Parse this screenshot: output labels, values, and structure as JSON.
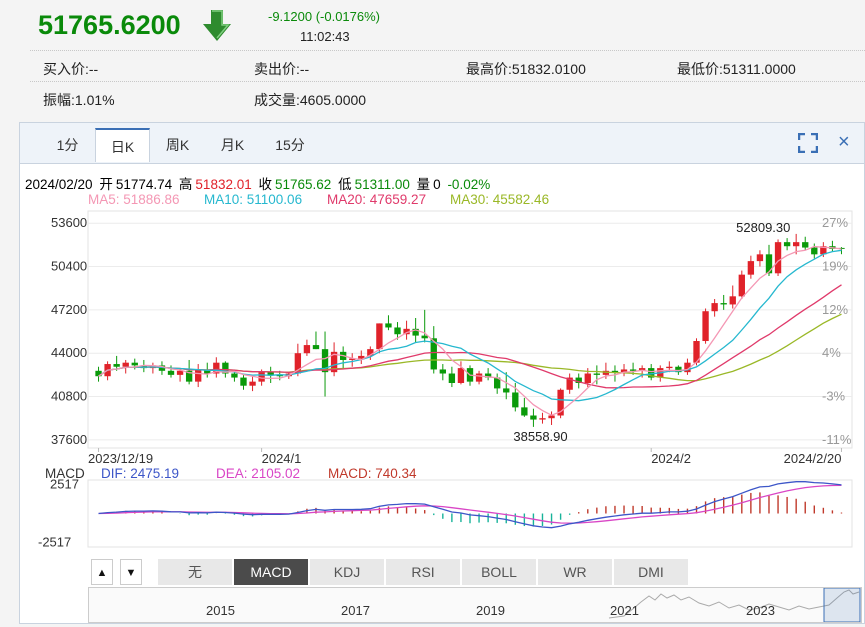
{
  "quote": {
    "price": "51765.6200",
    "change": "-9.1200 (-0.0176%)",
    "time": "11:02:43",
    "bid": "买入价:--",
    "ask": "卖出价:--",
    "high": "最高价:51832.0100",
    "low": "最低价:51311.0000",
    "amplitude": "振幅:1.01%",
    "volume": "成交量:4605.0000"
  },
  "tabs": [
    {
      "label": "1分",
      "active": false
    },
    {
      "label": "日K",
      "active": true
    },
    {
      "label": "周K",
      "active": false
    },
    {
      "label": "月K",
      "active": false
    },
    {
      "label": "15分",
      "active": false
    }
  ],
  "ohlc": {
    "date": "2024/02/20",
    "open_label": "开",
    "open": "51774.74",
    "high_label": "高",
    "high": "51832.01",
    "close_label": "收",
    "close": "51765.62",
    "low_label": "低",
    "low": "51311.00",
    "vol_label": "量",
    "vol": "0",
    "change": "-0.02%"
  },
  "ma_legend": {
    "ma5": "MA5: 51886.86",
    "ma10": "MA10: 51100.06",
    "ma20": "MA20: 47659.27",
    "ma30": "MA30: 45582.46"
  },
  "macd_legend": {
    "title": "MACD",
    "dif": "DIF: 2475.19",
    "dea": "DEA: 2105.02",
    "macd": "MACD: 740.34"
  },
  "indicators": [
    {
      "label": "无",
      "active": false
    },
    {
      "label": "MACD",
      "active": true
    },
    {
      "label": "KDJ",
      "active": false
    },
    {
      "label": "RSI",
      "active": false
    },
    {
      "label": "BOLL",
      "active": false
    },
    {
      "label": "WR",
      "active": false
    },
    {
      "label": "DMI",
      "active": false
    }
  ],
  "overview_years": [
    "2015",
    "2017",
    "2019",
    "2021",
    "2023"
  ],
  "colors": {
    "up": "#e0222a",
    "down": "#0a9a0a",
    "ma5": "#f497b4",
    "ma10": "#26b8cf",
    "ma20": "#e03a6b",
    "ma30": "#9ab827",
    "dif": "#3d56c8",
    "dea": "#d946c6"
  },
  "chart_data": {
    "type": "candlestick",
    "price_axis": {
      "ticks": [
        "53600",
        "50400",
        "47200",
        "44000",
        "40800",
        "37600"
      ],
      "ylim": [
        37000,
        54500
      ]
    },
    "pct_axis": {
      "ticks": [
        "27%",
        "19%",
        "12%",
        "4%",
        "-3%",
        "-11%"
      ]
    },
    "x_ticks": [
      "2023/12/19",
      "2024/1",
      "2024/2",
      "2024/2/20"
    ],
    "annotations": {
      "max_label": "52809.30",
      "min_label": "38558.90"
    },
    "macd_axis": {
      "ticks": [
        "2517",
        "-2517"
      ]
    },
    "candles": [
      [
        42700,
        43000,
        41900,
        42300
      ],
      [
        42300,
        43400,
        42000,
        43200
      ],
      [
        43200,
        43800,
        42700,
        43000
      ],
      [
        43000,
        43500,
        42500,
        43300
      ],
      [
        43300,
        43600,
        42800,
        43100
      ],
      [
        43100,
        43500,
        42600,
        42900
      ],
      [
        42900,
        43300,
        42500,
        43100
      ],
      [
        43100,
        43400,
        42400,
        42700
      ],
      [
        42700,
        43100,
        42200,
        42400
      ],
      [
        42400,
        42900,
        41900,
        42700
      ],
      [
        42700,
        43500,
        41700,
        41900
      ],
      [
        41900,
        43200,
        41500,
        42800
      ],
      [
        42800,
        43300,
        42200,
        42500
      ],
      [
        42500,
        43700,
        42200,
        43300
      ],
      [
        43300,
        43400,
        42200,
        42500
      ],
      [
        42500,
        42800,
        41900,
        42200
      ],
      [
        42200,
        42400,
        41300,
        41600
      ],
      [
        41600,
        42300,
        41200,
        41900
      ],
      [
        41900,
        42800,
        41600,
        42600
      ],
      [
        42600,
        43000,
        41800,
        42400
      ],
      [
        42400,
        42700,
        42000,
        42300
      ],
      [
        42300,
        42600,
        42100,
        42500
      ],
      [
        42500,
        44700,
        42300,
        44000
      ],
      [
        44000,
        45000,
        43800,
        44600
      ],
      [
        44600,
        45600,
        44300,
        44300
      ],
      [
        44300,
        45600,
        40800,
        42600
      ],
      [
        42600,
        44800,
        42300,
        44100
      ],
      [
        44100,
        44500,
        42900,
        43500
      ],
      [
        43500,
        44000,
        43000,
        43600
      ],
      [
        43600,
        44200,
        43200,
        43800
      ],
      [
        43800,
        44500,
        43500,
        44300
      ],
      [
        44300,
        46200,
        44000,
        46200
      ],
      [
        46200,
        46800,
        45700,
        45900
      ],
      [
        45900,
        46300,
        45000,
        45400
      ],
      [
        45400,
        46400,
        45000,
        45800
      ],
      [
        45800,
        46600,
        44800,
        45300
      ],
      [
        45300,
        47200,
        44800,
        45100
      ],
      [
        45100,
        46000,
        42500,
        42800
      ],
      [
        42800,
        43200,
        42000,
        42500
      ],
      [
        42500,
        43000,
        41500,
        41800
      ],
      [
        41800,
        43400,
        41700,
        42900
      ],
      [
        42900,
        43100,
        41600,
        41900
      ],
      [
        41900,
        42700,
        41700,
        42500
      ],
      [
        42500,
        42900,
        42000,
        42200
      ],
      [
        42200,
        42500,
        41000,
        41400
      ],
      [
        41400,
        42600,
        40600,
        41100
      ],
      [
        41100,
        41800,
        39700,
        40000
      ],
      [
        40000,
        40700,
        39300,
        39400
      ],
      [
        39400,
        39900,
        38559,
        39100
      ],
      [
        39100,
        39600,
        38800,
        39200
      ],
      [
        39200,
        39700,
        38700,
        39400
      ],
      [
        39400,
        41400,
        39200,
        41300
      ],
      [
        41300,
        42500,
        41000,
        42200
      ],
      [
        42200,
        42500,
        41400,
        41800
      ],
      [
        41800,
        42900,
        41500,
        42500
      ],
      [
        42500,
        43100,
        41700,
        42400
      ],
      [
        42400,
        43300,
        42100,
        42700
      ],
      [
        42700,
        43100,
        41900,
        42600
      ],
      [
        42600,
        43200,
        42300,
        42800
      ],
      [
        42800,
        43300,
        42400,
        42700
      ],
      [
        42700,
        43100,
        42200,
        42900
      ],
      [
        42900,
        43200,
        42000,
        42200
      ],
      [
        42200,
        43100,
        41900,
        42900
      ],
      [
        42900,
        43400,
        42600,
        43000
      ],
      [
        43000,
        43100,
        42400,
        42600
      ],
      [
        42600,
        43600,
        42400,
        43300
      ],
      [
        43300,
        45100,
        43100,
        44900
      ],
      [
        44900,
        47300,
        44700,
        47100
      ],
      [
        47100,
        48000,
        46700,
        47700
      ],
      [
        47700,
        48300,
        47200,
        47600
      ],
      [
        47600,
        49000,
        47300,
        48200
      ],
      [
        48200,
        50100,
        48000,
        49800
      ],
      [
        49800,
        51200,
        49500,
        50800
      ],
      [
        50800,
        51600,
        50400,
        51300
      ],
      [
        51300,
        52000,
        49700,
        49900
      ],
      [
        49900,
        52400,
        49700,
        52200
      ],
      [
        52200,
        52500,
        51600,
        51900
      ],
      [
        51900,
        52809,
        51300,
        52200
      ],
      [
        52200,
        52600,
        51600,
        51800
      ],
      [
        51800,
        52100,
        51000,
        51300
      ],
      [
        51300,
        52200,
        51100,
        51900
      ],
      [
        51900,
        52300,
        51500,
        51700
      ],
      [
        51775,
        51832,
        51311,
        51766
      ]
    ],
    "ma5_end": 51886.86,
    "ma10_end": 51100.06,
    "ma20_end": 47659.27,
    "ma30_end": 45582.46,
    "macd_end": {
      "dif": 2475.19,
      "dea": 2105.02,
      "macd": 740.34
    }
  }
}
